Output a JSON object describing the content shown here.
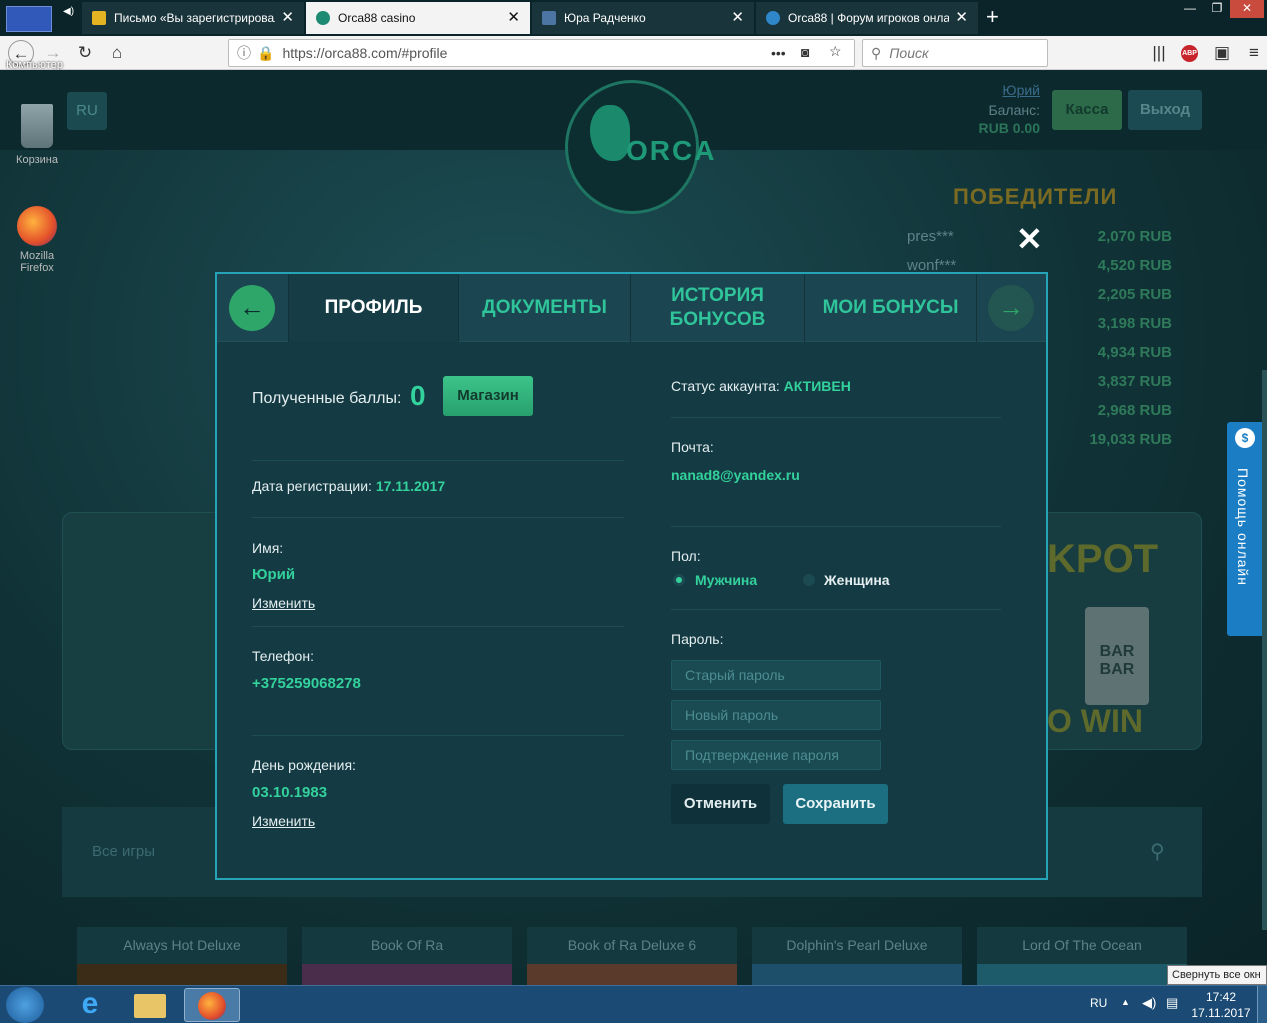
{
  "browser": {
    "tabs": [
      {
        "title": "Письмо «Вы зарегистрировал",
        "active": false
      },
      {
        "title": "Orca88 casino",
        "active": true
      },
      {
        "title": "Юра Радченко",
        "active": false
      },
      {
        "title": "Orca88 | Форум игроков онла",
        "active": false
      }
    ],
    "new_tab": "+",
    "url": "https://orca88.com/#profile",
    "search_placeholder": "Поиск",
    "overlay_label": "Компьютер",
    "dots": "•••"
  },
  "desktop": {
    "recycle_bin": "Корзина",
    "firefox_label_1": "Mozilla",
    "firefox_label_2": "Firefox"
  },
  "site": {
    "lang": "RU",
    "logo_text": "ORCA",
    "user_name": "Юрий",
    "balance_label": "Баланс:",
    "balance_value": "RUB 0.00",
    "cashier_button": "Касса",
    "logout_button": "Выход",
    "winners_title": "ПОБЕДИТЕЛИ",
    "winners": [
      {
        "name": "pres***",
        "amount": "2,070 RUB"
      },
      {
        "name": "wonf***",
        "amount": "4,520 RUB"
      },
      {
        "name": "",
        "amount": "2,205 RUB"
      },
      {
        "name": "",
        "amount": "3,198 RUB"
      },
      {
        "name": "",
        "amount": "4,934 RUB"
      },
      {
        "name": "",
        "amount": "3,837 RUB"
      },
      {
        "name": "",
        "amount": "2,968 RUB"
      },
      {
        "name": "",
        "amount": "19,033 RUB"
      }
    ],
    "jackpot_text": "KPOT",
    "jackpot_bottom": "O WIN",
    "bar1": "BAR",
    "bar2": "BAR",
    "search_placeholder": "Все игры",
    "help_text": "Помощь онлайн",
    "games": [
      "Always Hot Deluxe",
      "Book Of Ra",
      "Book of Ra Deluxe 6",
      "Dolphin's Pearl Deluxe",
      "Lord Of The Ocean"
    ]
  },
  "modal": {
    "close": "✕",
    "tabs": [
      {
        "label": "ПРОФИЛЬ",
        "active": true
      },
      {
        "label": "ДОКУМЕНТЫ",
        "active": false
      },
      {
        "label": "ИСТОРИЯ",
        "label2": "БОНУСОВ",
        "active": false
      },
      {
        "label": "МОИ БОНУСЫ",
        "active": false
      }
    ],
    "points_label": "Полученные баллы:",
    "points_value": "0",
    "shop_button": "Магазин",
    "reg_label": "Дата регистрации:",
    "reg_value": "17.11.2017",
    "name_label": "Имя:",
    "name_value": "Юрий",
    "change_link": "Изменить",
    "phone_label": "Телефон:",
    "phone_value": "+375259068278",
    "birthday_label": "День рождения:",
    "birthday_value": "03.10.1983",
    "status_label": "Статус аккаунта:",
    "status_value": "АКТИВЕН",
    "email_label": "Почта:",
    "email_value": "nanad8@yandex.ru",
    "gender_label": "Пол:",
    "gender_male": "Мужчина",
    "gender_female": "Женщина",
    "gender_selected": "male",
    "password_label": "Пароль:",
    "old_password_ph": "Старый пароль",
    "new_password_ph": "Новый пароль",
    "confirm_password_ph": "Подтверждение пароля",
    "cancel_button": "Отменить",
    "save_button": "Сохранить"
  },
  "taskbar": {
    "lang": "RU",
    "time": "17:42",
    "date": "17.11.2017",
    "tooltip": "Свернуть все окн"
  },
  "colors": {
    "accent": "#33d19c",
    "modal_border": "#26a3b6",
    "button_green": "#2fb57a"
  }
}
